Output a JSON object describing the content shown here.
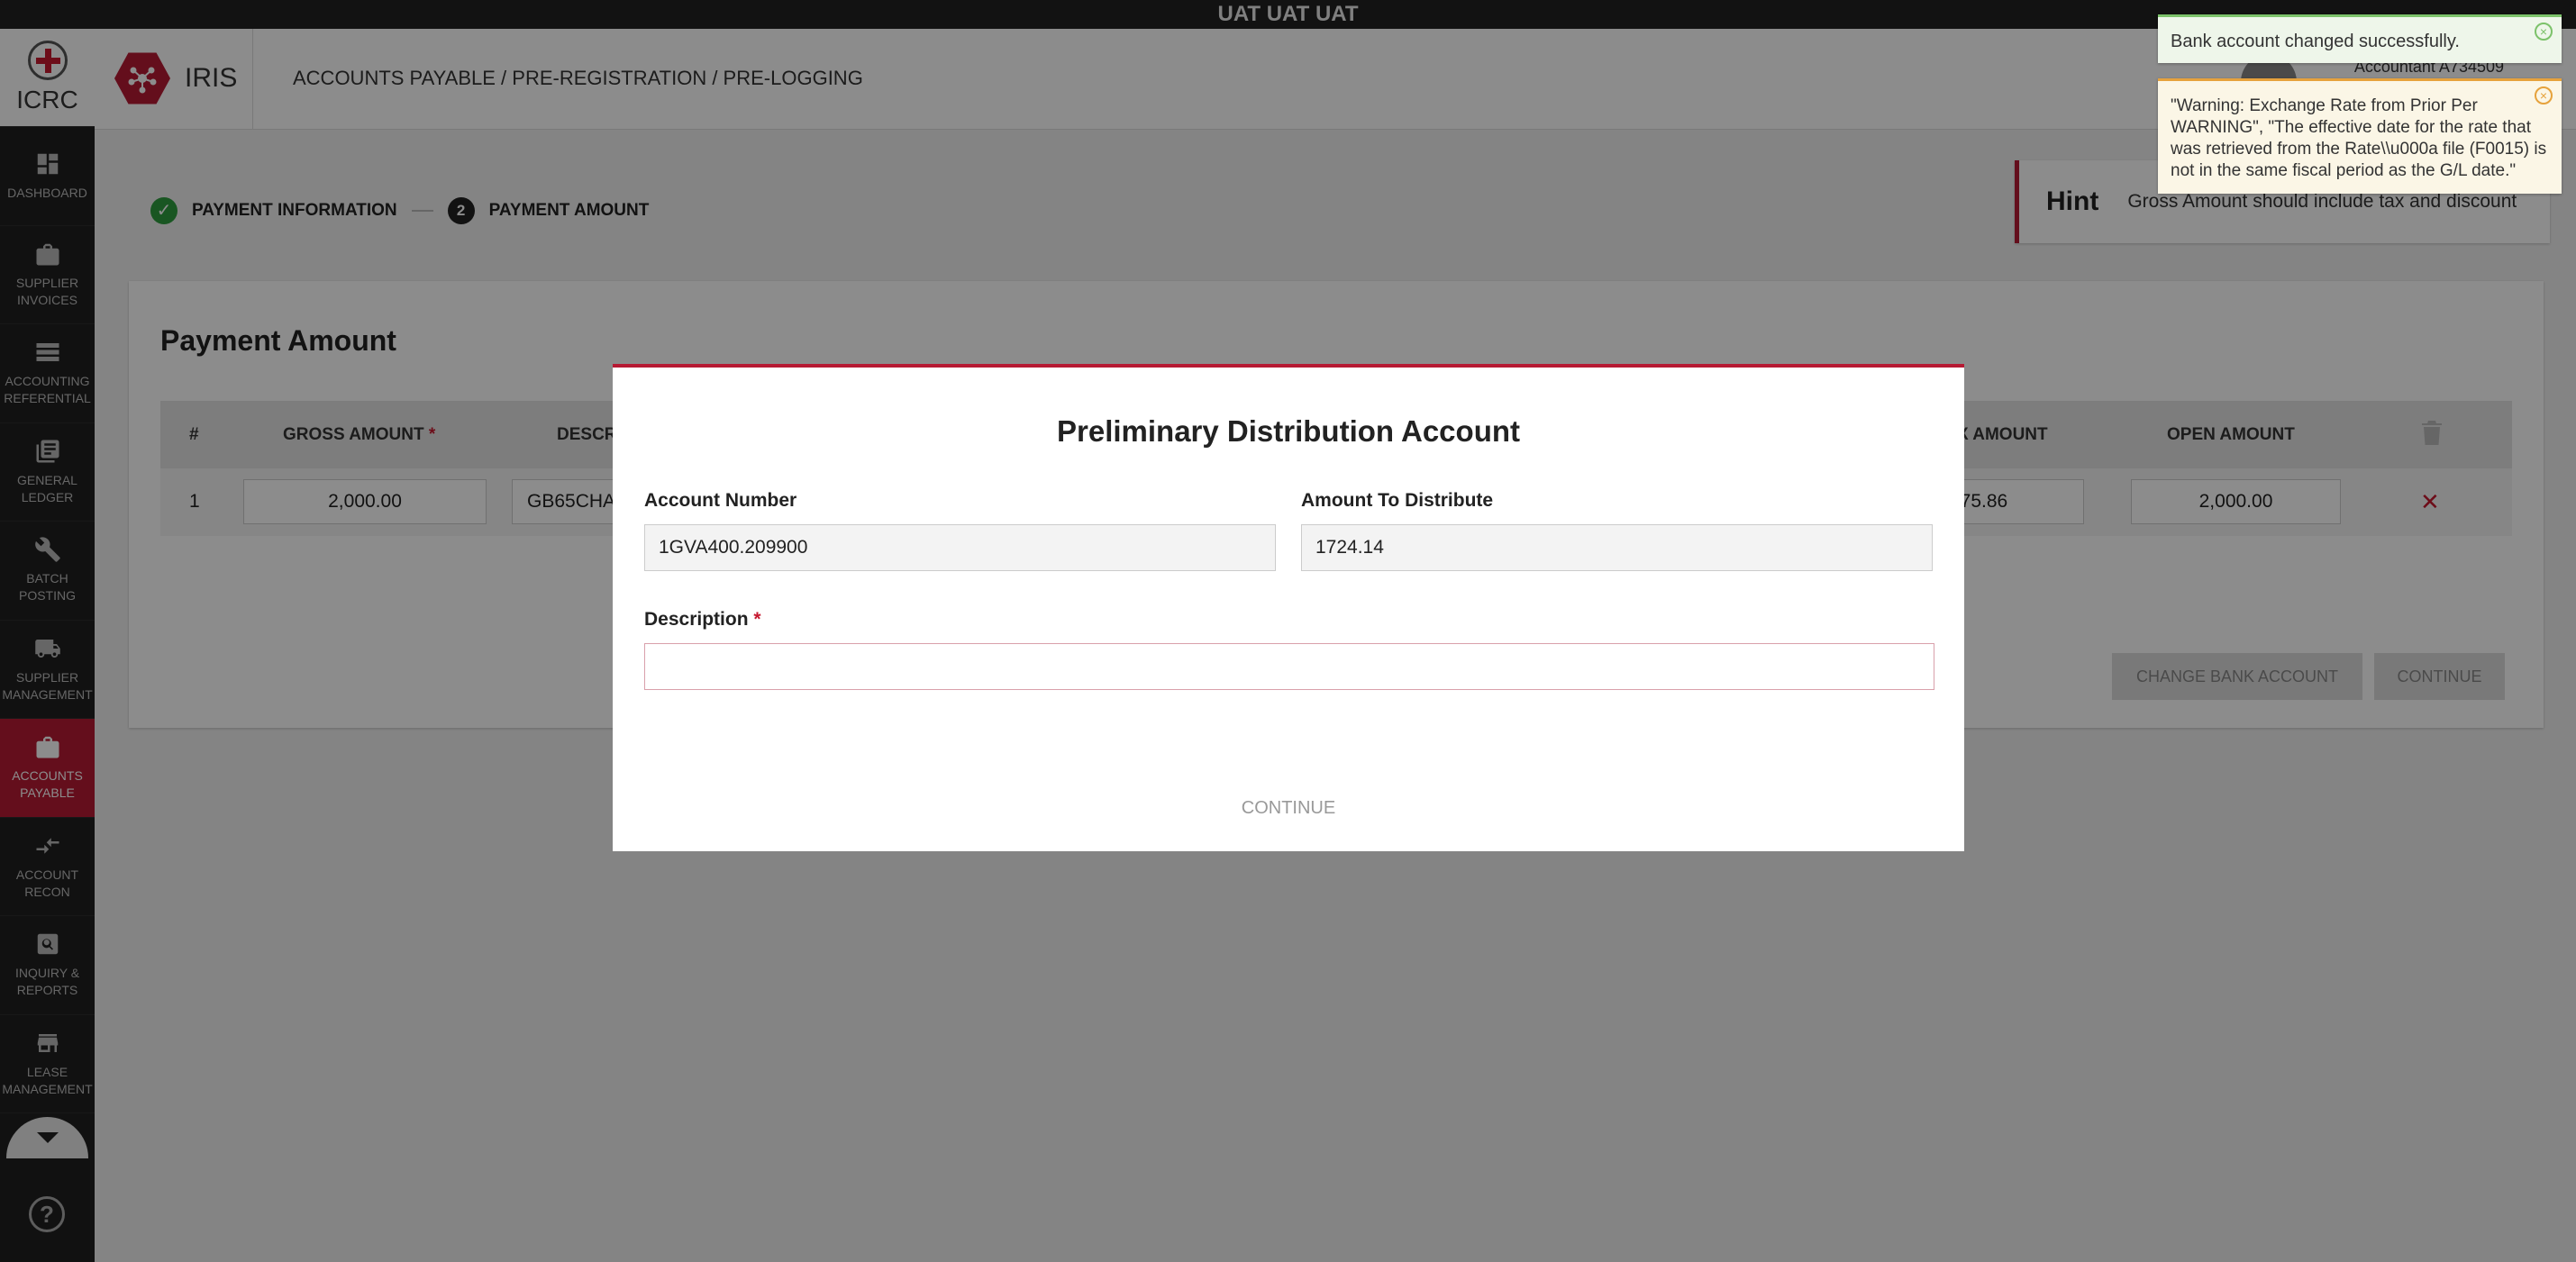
{
  "topbar": {
    "title": "UAT UAT UAT"
  },
  "logo": {
    "text": "ICRC"
  },
  "sidebar": {
    "items": [
      {
        "label": "DASHBOARD",
        "icon": "dashboard-icon"
      },
      {
        "label": "SUPPLIER INVOICES",
        "icon": "briefcase-icon"
      },
      {
        "label": "ACCOUNTING REFERENTIAL",
        "icon": "storage-icon"
      },
      {
        "label": "GENERAL LEDGER",
        "icon": "ledger-icon"
      },
      {
        "label": "BATCH POSTING",
        "icon": "wrench-icon"
      },
      {
        "label": "SUPPLIER MANAGEMENT",
        "icon": "truck-icon"
      },
      {
        "label": "ACCOUNTS PAYABLE",
        "icon": "briefcase-icon",
        "active": true
      },
      {
        "label": "ACCOUNT RECON",
        "icon": "compare-arrows-icon"
      },
      {
        "label": "INQUIRY & REPORTS",
        "icon": "search-icon"
      },
      {
        "label": "LEASE MANAGEMENT",
        "icon": "store-icon"
      }
    ],
    "help": "?"
  },
  "header": {
    "app_name": "IRIS",
    "breadcrumb": "ACCOUNTS PAYABLE / PRE-REGISTRATION / PRE-LOGGING",
    "user": "Accountant A734509"
  },
  "stepper": {
    "step1_label": "PAYMENT INFORMATION",
    "step2_number": "2",
    "step2_label": "PAYMENT AMOUNT"
  },
  "hint": {
    "title": "Hint",
    "text": "Gross Amount should include tax and discount"
  },
  "card": {
    "title": "Payment Amount",
    "columns": {
      "num": "#",
      "gross": "GROSS AMOUNT",
      "gross_required": "*",
      "desc": "DESCR",
      "tax": "X AMOUNT",
      "open": "OPEN AMOUNT"
    },
    "row": {
      "num": "1",
      "gross": "2,000.00",
      "desc": "GB65CHA",
      "tax": "275.86",
      "open": "2,000.00",
      "remove": "✕"
    },
    "change_bank_label": "CHANGE BANK ACCOUNT",
    "continue_label": "CONTINUE"
  },
  "toasts": {
    "success": "Bank account changed successfully.",
    "warning": "\"Warning: Exchange Rate from Prior Per WARNING\", \"The effective date for the rate that was retrieved from the Rate\\\\u000a file (F0015) is not in the same fiscal period as the G/L date.\"",
    "close": "×"
  },
  "modal": {
    "title": "Preliminary Distribution Account",
    "account_number_label": "Account Number",
    "account_number_value": "1GVA400.209900",
    "amount_label": "Amount To Distribute",
    "amount_value": "1724.14",
    "description_label": "Description",
    "description_required": "*",
    "description_value": "",
    "continue_label": "CONTINUE"
  },
  "colors": {
    "brand": "#b61a33",
    "success": "#7cc26a",
    "warning": "#e6a23c",
    "sidebar": "#202020"
  }
}
